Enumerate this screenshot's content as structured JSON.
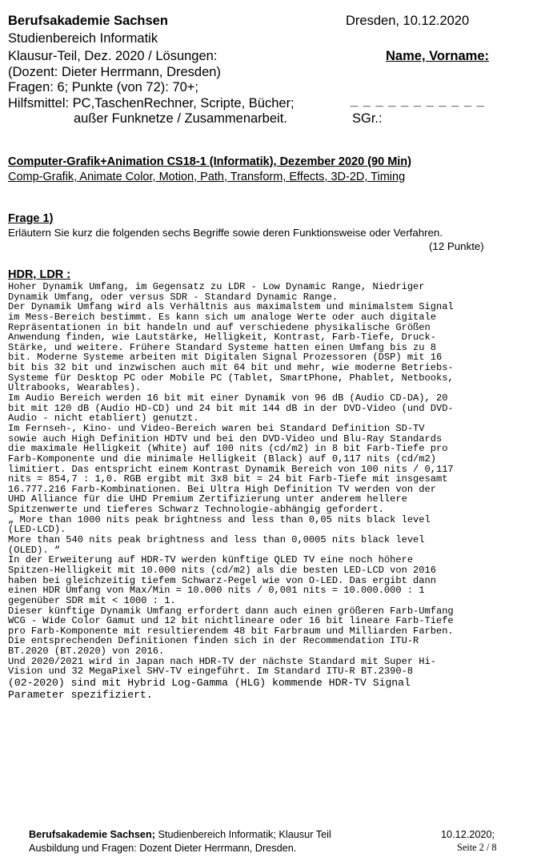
{
  "header": {
    "institution": "Berufsakademie Sachsen",
    "place_date": "Dresden, 10.12.2020",
    "department": "Studienbereich Informatik",
    "exam_title": "Klausur-Teil, Dez. 2020 / Lösungen:",
    "name_field_label": "Name, Vorname:",
    "lecturer": "(Dozent: Dieter Herrmann, Dresden)",
    "questions_points": "Fragen: 6; Punkte (von 72): 70+;",
    "aids_line1": "Hilfsmittel: PC,TaschenRechner, Scripte, Bücher;",
    "aids_line2": "außer Funknetze / Zusammenarbeit.",
    "blank_line": "_ _ _ _ _ _ _ _ _ _ _",
    "sgr_label": "SGr.:"
  },
  "course": {
    "title": "Computer-Grafik+Animation CS18-1 (Informatik), Dezember 2020 (90 Min)",
    "topics": "Comp-Grafik, Animate Color, Motion, Path, Transform, Effects, 3D-2D, Timing"
  },
  "question": {
    "label": "Frage 1)",
    "text": "Erläutern Sie kurz die folgenden sechs Begriffe sowie deren Funktionsweise oder Verfahren.",
    "points": "(12 Punkte)"
  },
  "answer": {
    "heading": "HDR, LDR :",
    "lines": [
      "Hoher Dynamik Umfang, im Gegensatz zu LDR - Low Dynamic Range, Niedriger",
      "Dynamik Umfang, oder versus SDR - Standard Dynamic Range.",
      "Der Dynamik Umfang wird als Verhältnis aus maximalstem und minimalstem Signal",
      "im Mess-Bereich bestimmt. Es kann sich um analoge Werte oder auch digitale",
      "Repräsentationen in bit handeln und auf verschiedene physikalische Größen",
      "Anwendung finden, wie Lautstärke, Helligkeit, Kontrast, Farb-Tiefe, Druck-",
      "Stärke, und weitere. Frühere Standard Systeme hatten einen Umfang bis zu 8",
      "bit. Moderne Systeme arbeiten mit Digitalen Signal Prozessoren (DSP) mit 16",
      "bit bis 32 bit und inzwischen auch mit 64 bit und mehr, wie moderne Betriebs-",
      "Systeme für Desktop PC oder Mobile PC (Tablet, SmartPhone, Phablet, Netbooks,",
      "Ultrabooks, Wearables).",
      "Im Audio Bereich werden 16 bit mit einer Dynamik von 96 dB (Audio CD-DA), 20",
      "bit mit 120 dB (Audio HD-CD) und 24 bit mit 144 dB in der DVD-Video (und DVD-",
      "Audio - nicht etabliert) genutzt.",
      "Im Fernseh-, Kino- und Video-Bereich waren bei Standard Definition SD-TV",
      "sowie auch High Definition HDTV und bei den DVD-Video und Blu-Ray Standards",
      "die maximale Helligkeit (White) auf 100 nits (cd/m2) in 8 bit Farb-Tiefe pro",
      "Farb-Komponente und die minimale Helligkeit (Black) auf 0,117 nits (cd/m2)",
      "limitiert. Das entspricht einem Kontrast Dynamik Bereich von 100 nits / 0,117",
      "nits = 854,7 : 1,0. RGB ergibt mit 3x8 bit = 24 bit Farb-Tiefe mit insgesamt",
      "16.777.216 Farb-Kombinationen. Bei Ultra High Definition TV werden von der",
      "UHD Alliance für die UHD Premium Zertifizierung unter anderem hellere",
      "Spitzenwerte und tieferes Schwarz Technologie-abhängig gefordert.",
      "„ More than 1000 nits peak brightness and less than 0,05 nits black level",
      "(LED-LCD).",
      "More than 540 nits peak brightness and less than 0,0005 nits black level",
      "(OLED). “",
      "In der Erweiterung auf HDR-TV werden künftige QLED TV eine noch höhere",
      "Spitzen-Helligkeit mit 10.000 nits (cd/m2) als die besten LED-LCD von 2016",
      "haben bei gleichzeitig tiefem Schwarz-Pegel wie von O-LED. Das ergibt dann",
      "einen HDR Umfang von Max/Min = 10.000 nits / 0,001 nits = 10.000.000 : 1",
      "gegenüber SDR mit < 1000 : 1.",
      "Dieser künftige Dynamik Umfang erfordert dann auch einen größeren Farb-Umfang",
      "WCG - Wide Color Gamut und 12 bit nichtlineare oder 16 bit lineare Farb-Tiefe",
      "pro Farb-Komponente mit resultierendem 48 bit Farbraum und Milliarden Farben.",
      "Die entsprechenden Definitionen finden sich in der Recommendation ITU-R",
      "BT.2020 (BT.2020) von 2016.",
      "Und 2020/2021 wird in Japan nach HDR-TV der nächste Standard mit Super Hi-",
      "Vision und 32 MegaPixel SHV-TV eingeführt. Im Standard ITU-R BT.2390-8",
      "(02-2020) sind mit Hybrid Log-Gamma (HLG) kommende HDR-TV Signal",
      "Parameter spezifiziert."
    ]
  },
  "footer": {
    "institution": "Berufsakademie Sachsen;",
    "rest_line1": " Studienbereich Informatik; Klausur Teil",
    "line2": "Ausbildung und Fragen: Dozent Dieter Herrmann, Dresden.",
    "date": "10.12.2020;",
    "page": "Seite 2 / 8"
  }
}
